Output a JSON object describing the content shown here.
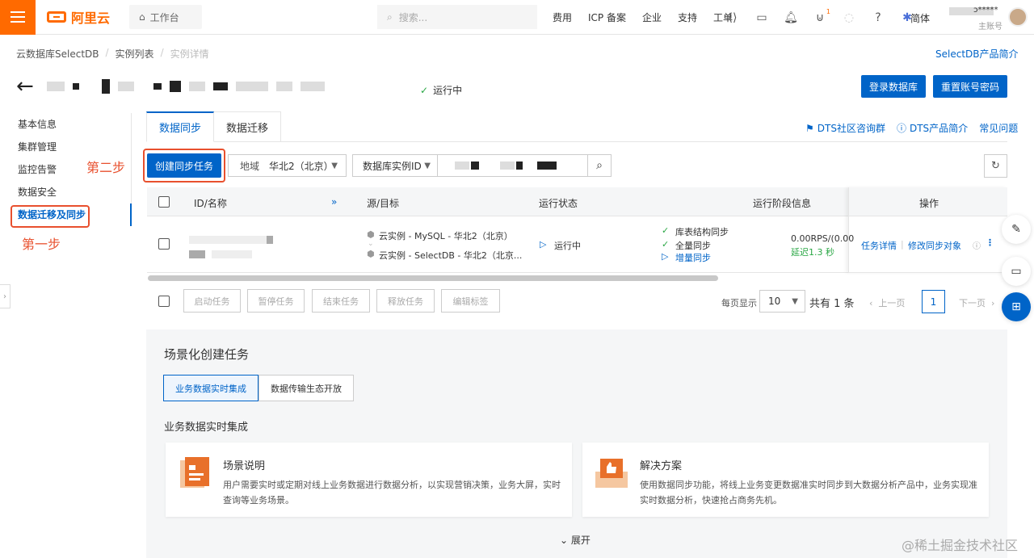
{
  "topbar": {
    "logo": "阿里云",
    "workbench": "工作台",
    "search_placeholder": "搜索...",
    "nav": [
      "费用",
      "ICP 备案",
      "企业",
      "支持",
      "工单"
    ],
    "cart_badge": "1",
    "lang": "简体",
    "account_name": "ɔ*****",
    "account_role": "主账号"
  },
  "breadcrumb": [
    "云数据库SelectDB",
    "实例列表",
    "实例详情"
  ],
  "intro_link": "SelectDB产品简介",
  "instance": {
    "status": "运行中",
    "login_btn": "登录数据库",
    "reset_btn": "重置账号密码"
  },
  "sidebar": {
    "items": [
      "基本信息",
      "集群管理",
      "监控告警",
      "数据安全",
      "数据迁移及同步"
    ]
  },
  "annotations": {
    "step1": "第一步",
    "step2": "第二步"
  },
  "tabs": [
    "数据同步",
    "数据迁移"
  ],
  "right_links": [
    "DTS社区咨询群",
    "DTS产品简介",
    "常见问题"
  ],
  "toolbar": {
    "create": "创建同步任务",
    "region_label": "地域",
    "region_value": "华北2（北京）",
    "id_select": "数据库实例ID"
  },
  "table": {
    "headers": [
      "ID/名称",
      "源/目标",
      "运行状态",
      "运行阶段信息",
      "操作"
    ],
    "row": {
      "source": "云实例 - MySQL - 华北2（北京）",
      "target": "云实例 - SelectDB - 华北2（北京...",
      "status": "运行中",
      "stages": [
        "库表结构同步",
        "全量同步",
        "增量同步"
      ],
      "rps": "0.00RPS/(0.00",
      "delay": "延迟1.3 秒",
      "actions": [
        "任务详情",
        "修改同步对象"
      ]
    }
  },
  "bulk": [
    "启动任务",
    "暂停任务",
    "结束任务",
    "释放任务",
    "编辑标签"
  ],
  "pager": {
    "per_page_label": "每页显示",
    "per_page": "10",
    "total": "共有 1 条",
    "prev": "上一页",
    "page": "1",
    "next": "下一页"
  },
  "scene": {
    "title": "场景化创建任务",
    "tabs": [
      "业务数据实时集成",
      "数据传输生态开放"
    ],
    "subtitle": "业务数据实时集成",
    "cards": [
      {
        "title": "场景说明",
        "desc": "用户需要实时或定期对线上业务数据进行数据分析，以实现营销决策，业务大屏，实时查询等业务场景。"
      },
      {
        "title": "解决方案",
        "desc": "使用数据同步功能，将线上业务变更数据准实时同步到大数据分析产品中，业务实现准实时数据分析，快速抢占商务先机。"
      }
    ],
    "expand": "展开"
  },
  "watermark": "@稀土掘金技术社区"
}
